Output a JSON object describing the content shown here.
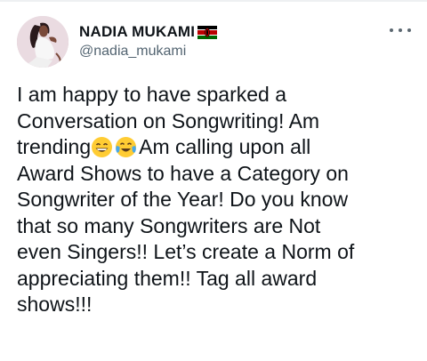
{
  "author": {
    "display_name": "NADIA MUKAMI",
    "handle": "@nadia_mukami",
    "flag_icon": "kenya-flag-icon",
    "avatar_icon": "profile-photo"
  },
  "menu": {
    "icon": "more-options-icon"
  },
  "tweet": {
    "line1": "I am happy to have sparked a",
    "line2": "Conversation on Songwriting! Am",
    "line3_pre": "trending",
    "line3_post": "Am calling upon all",
    "line4": "Award Shows to have a Category on",
    "line5": "Songwriter of the Year! Do you know",
    "line6": "that so many Songwriters are Not",
    "line7": "even Singers!! Let’s create a Norm of",
    "line8": "appreciating them!! Tag all award",
    "line9": "shows!!!",
    "emojis": [
      "grinning-face-with-smiling-eyes",
      "face-with-tears-of-joy"
    ]
  },
  "colors": {
    "text": "#0f1419",
    "secondary": "#536471",
    "kenya_black": "#000000",
    "kenya_red": "#bb0000",
    "kenya_green": "#006600",
    "emoji_yellow": "#ffcc33"
  }
}
